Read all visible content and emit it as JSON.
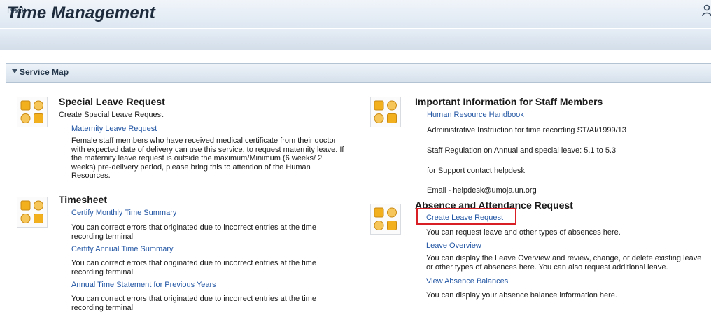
{
  "header": {
    "title": "Time Management"
  },
  "toolbar": {
    "back_label": "Back"
  },
  "panel": {
    "title": "Service Map"
  },
  "special_leave": {
    "heading": "Special Leave Request",
    "subheading": "Create Special Leave Request",
    "link": "Maternity Leave Request",
    "desc": [
      "Female staff members who have received medical certificate from their doctor",
      "with expected date of delivery can use this service, to request maternity leave. If",
      "the maternity leave request is outside the maximum/Minimum (6 weeks/ 2",
      "weeks) pre-delivery period, please bring this to attention of the Human",
      "Resources."
    ]
  },
  "timesheet": {
    "heading": "Timesheet",
    "items": [
      {
        "link": "Certify Monthly Time Summary",
        "desc": [
          "You can correct errors that originated due to incorrect entries at the time",
          "recording terminal"
        ]
      },
      {
        "link": "Certify Annual Time Summary",
        "desc": [
          "You can correct errors that originated due to incorrect entries at the time",
          "recording terminal"
        ]
      },
      {
        "link": "Annual Time Statement for Previous Years",
        "desc": [
          "You can correct errors that originated due to incorrect entries at the time",
          "recording terminal"
        ]
      }
    ]
  },
  "important_info": {
    "heading": "Important Information for Staff Members",
    "link": "Human Resource Handbook",
    "lines": [
      "Administrative Instruction for time recording ST/AI/1999/13",
      "Staff Regulation on Annual and special leave: 5.1 to 5.3",
      "for Support contact helpdesk",
      "Email - helpdesk@umoja.un.org"
    ]
  },
  "absence": {
    "heading": "Absence and Attendance Request",
    "items": [
      {
        "link": "Create Leave Request",
        "desc": [
          "You can request leave and other types of absences here."
        ]
      },
      {
        "link": "Leave Overview",
        "desc": [
          "You can display the Leave Overview and review, change, or delete existing leave",
          "or other types of absences here. You can also request additional leave."
        ]
      },
      {
        "link": "View Absence Balances",
        "desc": [
          "You can display your absence balance information here."
        ]
      }
    ]
  },
  "colors": {
    "link": "#2155a3",
    "highlight": "#d81f26",
    "header_bg": "#dde7f2",
    "icon_orange": "#f0a820"
  }
}
